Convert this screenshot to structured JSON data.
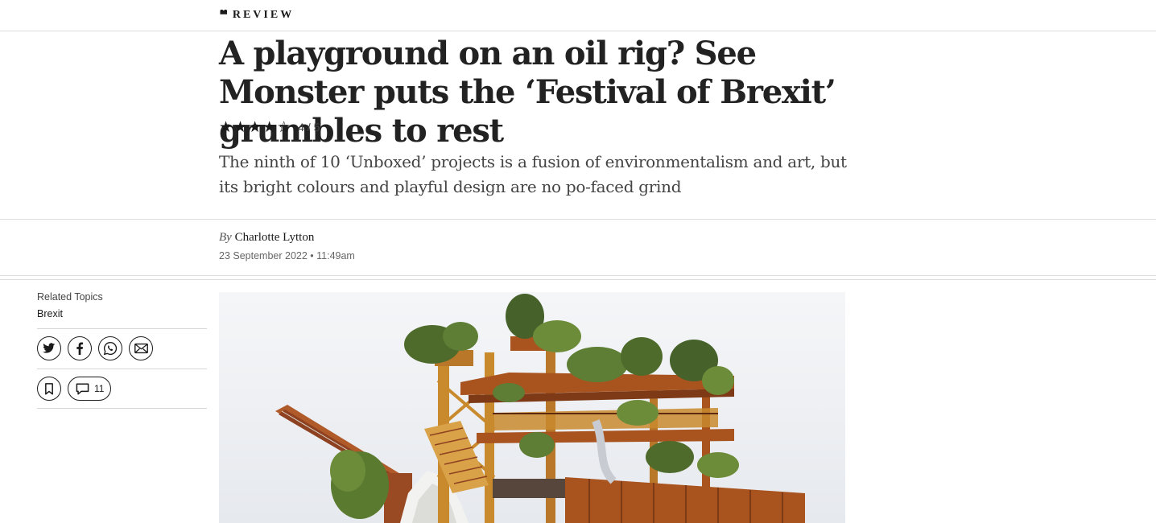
{
  "header": {
    "kicker_icon": "quote-icon",
    "kicker_label": "REVIEW"
  },
  "article": {
    "headline": "A playground on an oil rig? See Monster puts the ‘Festival of Brexit’ grumbles to rest",
    "rating": {
      "value": 4,
      "max": 5,
      "stars": "★★★★☆",
      "label": "4 / 5"
    },
    "standfirst": "The ninth of 10 ‘Unboxed’ projects is a fusion of environmentalism and art, but its bright colours and playful design are no po-faced grind",
    "byline_prefix": "By",
    "author": "Charlotte Lytton",
    "date": "23 September 2022 • 11:49am"
  },
  "sidebar": {
    "related_label": "Related Topics",
    "topic": "Brexit",
    "share_icons": [
      "twitter-icon",
      "facebook-icon",
      "whatsapp-icon",
      "email-icon"
    ],
    "bookmark_icon": "bookmark-icon",
    "comment_icon": "comment-icon",
    "comment_count": "11"
  },
  "hero_image": {
    "subject": "oil-rig-sculpture-with-trees",
    "colors": {
      "sky": "#eef0f3",
      "rust": "#a9531f",
      "steel": "#c98a2e",
      "foliage": "#4f6b2c",
      "crane": "#b05a2a"
    }
  },
  "colors": {
    "text": "#1a1a1a",
    "muted": "#666666",
    "rule": "#dcdcdc",
    "background": "#ffffff"
  }
}
